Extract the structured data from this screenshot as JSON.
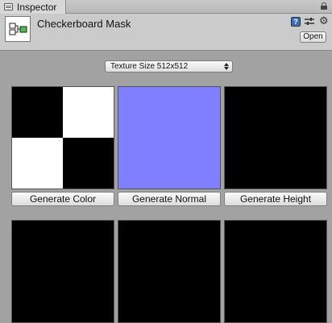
{
  "tab": {
    "label": "Inspector",
    "icon": "inspector-icon"
  },
  "header": {
    "title": "Checkerboard Mask",
    "asset_icon": "node-graph-icon",
    "help_icon_glyph": "?",
    "open_label": "Open"
  },
  "texture_size": {
    "selected": "Texture Size 512x512"
  },
  "buttons": {
    "generate_color": "Generate Color",
    "generate_normal": "Generate Normal",
    "generate_height": "Generate Height"
  },
  "colors": {
    "panel_bg": "#a2a2a2",
    "header_bg": "#cbcbcb",
    "normal_map": "#7f7fff",
    "checker_dark": "#000000",
    "checker_light": "#ffffff",
    "empty_preview": "#000000"
  },
  "previews": {
    "row1": [
      "checkerboard-color",
      "flat-normal",
      "height-black"
    ],
    "row2": [
      "empty",
      "empty",
      "empty"
    ]
  }
}
